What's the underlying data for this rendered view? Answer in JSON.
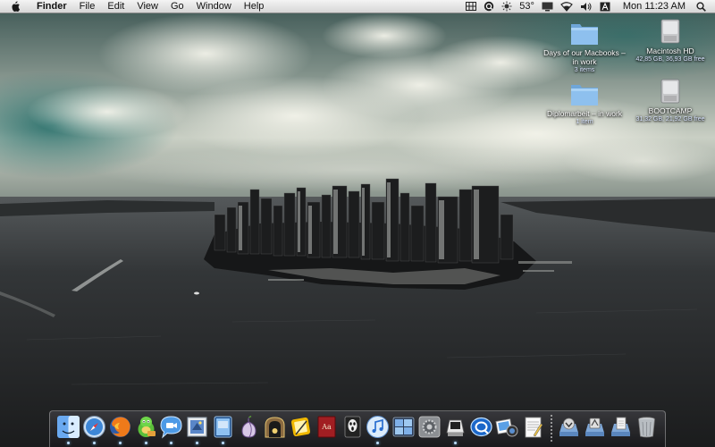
{
  "menubar": {
    "app_name": "Finder",
    "menus": [
      "File",
      "Edit",
      "View",
      "Go",
      "Window",
      "Help"
    ],
    "temperature": "53°",
    "clock": "Mon 11:23 AM"
  },
  "desktop": {
    "icons": [
      {
        "name": "Days of our Macbooks – in work",
        "sub": "3 items",
        "type": "folder"
      },
      {
        "name": "Macintosh HD",
        "sub": "42,85 GB, 36,93 GB free",
        "type": "drive"
      },
      {
        "name": "Diplomarbeit – in work",
        "sub": "1 item",
        "type": "folder"
      },
      {
        "name": "BOOTCAMP",
        "sub": "31,32 GB, 21,92 GB free",
        "type": "drive"
      }
    ]
  },
  "dock": {
    "apps": [
      {
        "icon": "finder-icon",
        "running": true
      },
      {
        "icon": "safari-icon",
        "running": true
      },
      {
        "icon": "firefox-icon",
        "running": true
      },
      {
        "icon": "adium-icon",
        "running": true
      },
      {
        "icon": "ichat-icon",
        "running": true
      },
      {
        "icon": "mail-icon",
        "running": true
      },
      {
        "icon": "preview-icon",
        "running": true
      },
      {
        "icon": "tor-onion-icon",
        "running": false
      },
      {
        "icon": "tunnel-icon",
        "running": false
      },
      {
        "icon": "pages-icon",
        "running": false
      },
      {
        "icon": "dictionary-icon",
        "running": false
      },
      {
        "icon": "scream-mask-icon",
        "running": false
      },
      {
        "icon": "itunes-icon",
        "running": true
      },
      {
        "icon": "spaces-icon",
        "running": false
      },
      {
        "icon": "system-preferences-icon",
        "running": false
      },
      {
        "icon": "terminal-icon",
        "running": true
      },
      {
        "icon": "quicktime-icon",
        "running": false
      },
      {
        "icon": "iphoto-icon",
        "running": false
      },
      {
        "icon": "textedit-icon",
        "running": false
      }
    ],
    "stacks": [
      {
        "icon": "downloads-stack-icon"
      },
      {
        "icon": "applications-stack-icon"
      },
      {
        "icon": "documents-stack-icon"
      },
      {
        "icon": "trash-icon"
      }
    ]
  }
}
